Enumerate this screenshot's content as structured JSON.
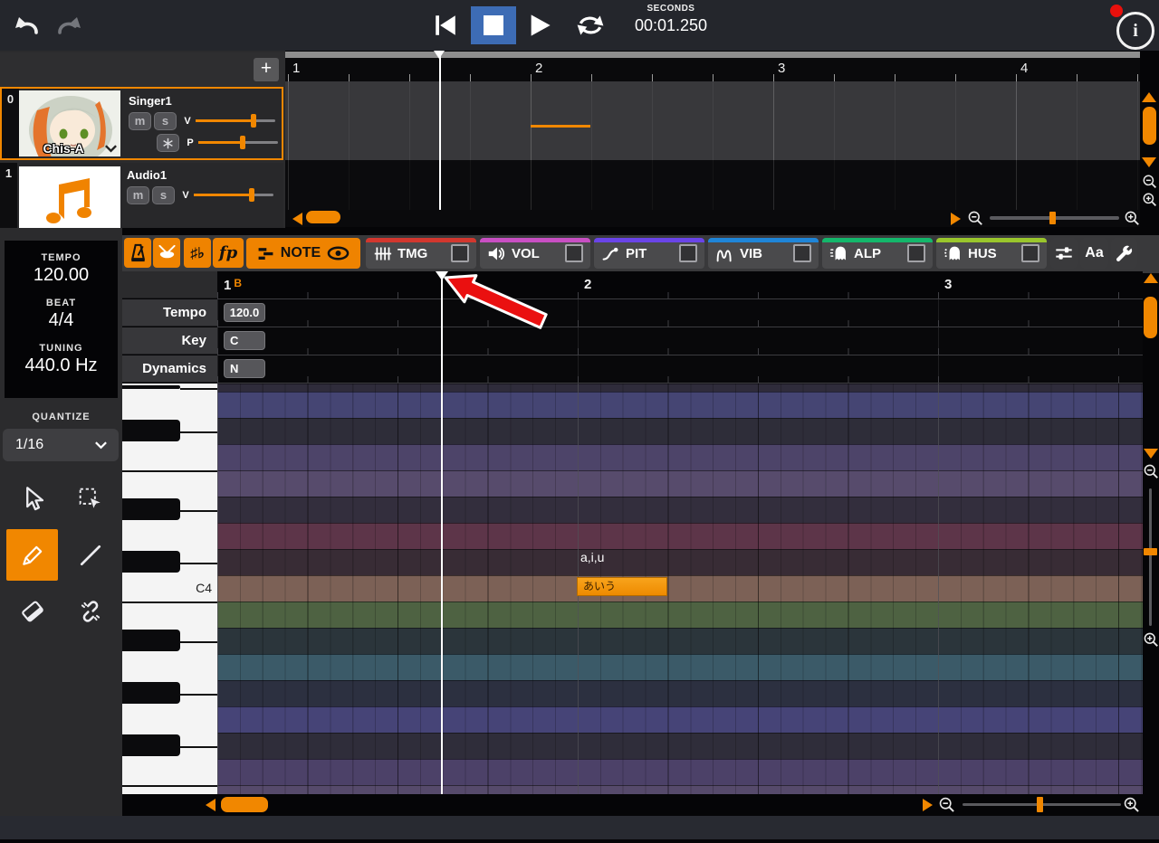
{
  "topbar": {
    "time_unit_label": "SECONDS",
    "time_value": "00:01.250"
  },
  "tracks_panel": {
    "add_button_label": "+",
    "tracks": [
      {
        "index": "0",
        "name": "Singer1",
        "voice_name": "Chis-A",
        "mute_label": "m",
        "solo_label": "s",
        "volume_label": "V",
        "pan_label": "P",
        "volume_pct": 72,
        "pitch_pct": 55,
        "selected": true
      },
      {
        "index": "1",
        "name": "Audio1",
        "mute_label": "m",
        "solo_label": "s",
        "volume_label": "V",
        "volume_pct": 72,
        "selected": false
      }
    ]
  },
  "timeline": {
    "measure_labels": [
      "1",
      "2",
      "3",
      "4"
    ]
  },
  "sidebar": {
    "tempo_label": "TEMPO",
    "tempo_value": "120.00",
    "beat_label": "BEAT",
    "beat_value": "4/4",
    "tuning_label": "TUNING",
    "tuning_value": "440.0 Hz",
    "quantize_label": "QUANTIZE",
    "quantize_value": "1/16",
    "tools": [
      "pointer-tool",
      "marquee-select-tool",
      "pencil-tool",
      "line-tool",
      "eraser-tool",
      "unlink-tool"
    ],
    "active_tool": "pencil-tool"
  },
  "tabbar": {
    "sharp_flat_glyph": "♯♭",
    "forte_piano_glyph": "fp",
    "note_tab_label": "NOTE",
    "font_button_label": "Aa",
    "param_tabs": [
      {
        "label": "TMG",
        "color": "#D2372E",
        "icon": "timing-icon",
        "checked": false
      },
      {
        "label": "VOL",
        "color": "#C94FC3",
        "icon": "volume-icon",
        "checked": false
      },
      {
        "label": "PIT",
        "color": "#6A44E8",
        "icon": "pitch-icon",
        "checked": false
      },
      {
        "label": "VIB",
        "color": "#1F85D8",
        "icon": "vibrato-icon",
        "checked": false
      },
      {
        "label": "ALP",
        "color": "#14B76B",
        "icon": "alpha-ghost-icon",
        "checked": false
      },
      {
        "label": "HUS",
        "color": "#9AC62C",
        "icon": "husky-ghost-icon",
        "checked": false
      }
    ]
  },
  "editor": {
    "ruler": {
      "measure_1": "1",
      "beat_flag": "B",
      "measure_2": "2",
      "measure_3": "3"
    },
    "param_rows": [
      {
        "label": "Tempo",
        "value": "120.0"
      },
      {
        "label": "Key",
        "value": "C"
      },
      {
        "label": "Dynamics",
        "value": "N"
      }
    ],
    "note": {
      "lyric": "あいう",
      "phoneme": "a,i,u",
      "pitch": "C4",
      "measure": 2,
      "beat": 1
    },
    "c4_label": "C4",
    "piano_rows": [
      {
        "pitch": "G#4",
        "color": "#2f2c3b"
      },
      {
        "pitch": "G4",
        "color": "#454573"
      },
      {
        "pitch": "F#4",
        "color": "#2e2d39"
      },
      {
        "pitch": "F4",
        "color": "#4d4469"
      },
      {
        "pitch": "E4",
        "color": "#574b6c"
      },
      {
        "pitch": "D#4",
        "color": "#332e3d"
      },
      {
        "pitch": "D4",
        "color": "#5d3549"
      },
      {
        "pitch": "C#4",
        "color": "#382c35"
      },
      {
        "pitch": "C4",
        "color": "#7c6156"
      },
      {
        "pitch": "B3",
        "color": "#4e6242"
      },
      {
        "pitch": "A#3",
        "color": "#2b353b"
      },
      {
        "pitch": "A3",
        "color": "#3b5a68"
      },
      {
        "pitch": "G#3",
        "color": "#2c3040"
      },
      {
        "pitch": "G3",
        "color": "#464477"
      },
      {
        "pitch": "F#3",
        "color": "#2f2d3a"
      },
      {
        "pitch": "F3",
        "color": "#4c4168"
      },
      {
        "pitch": "E3",
        "color": "#564a6b"
      }
    ]
  },
  "colors": {
    "accent_orange": "#F18700",
    "stop_button_blue": "#3D6CB5",
    "record_dot_red": "#E8100C",
    "playhead_white": "#FFFFFF",
    "annotation_arrow_red": "#EA1010"
  }
}
